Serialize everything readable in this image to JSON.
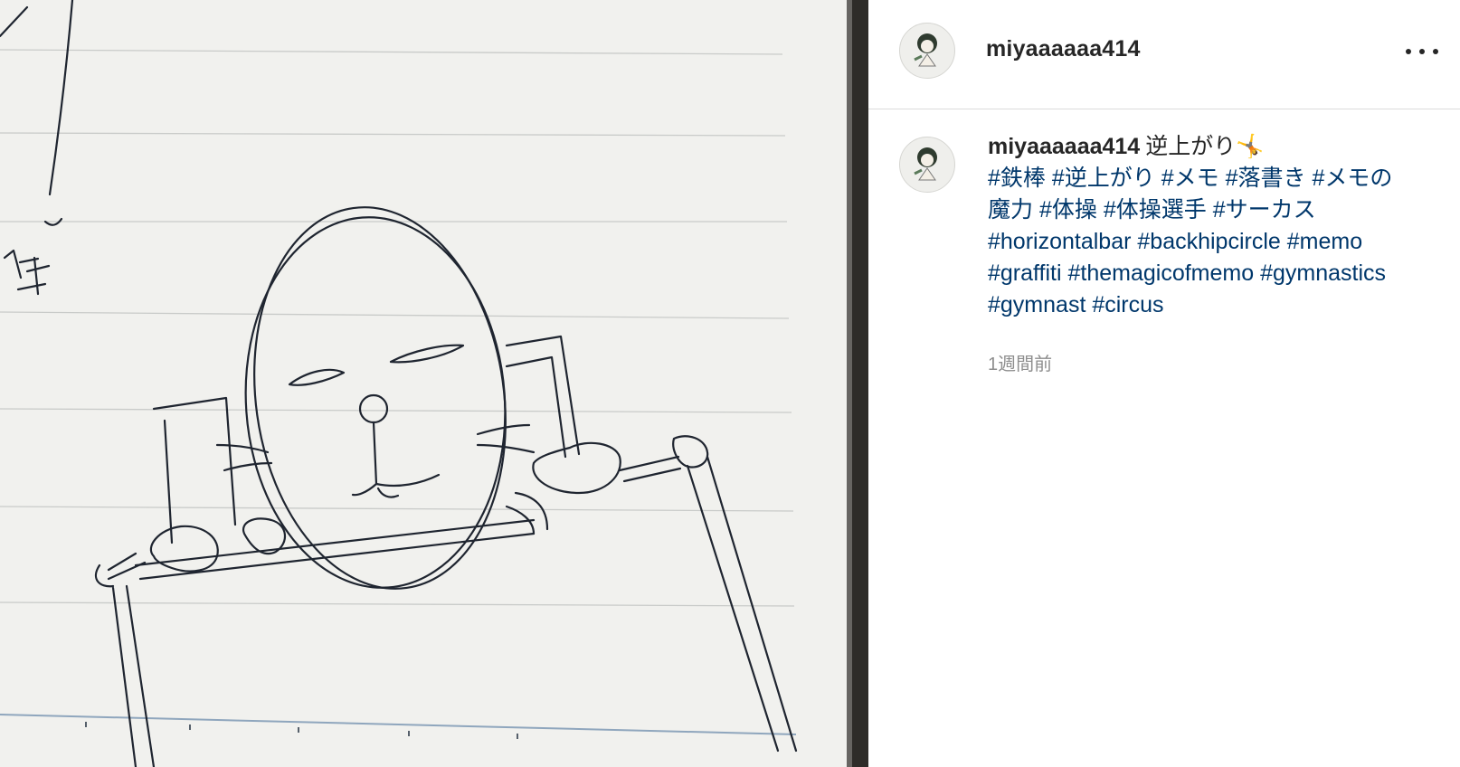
{
  "post": {
    "username": "miyaaaaaa414",
    "menu_icon": "more-horizontal-icon",
    "avatar_icon": "user-avatar-icon",
    "caption": {
      "username": "miyaaaaaa414",
      "text": "逆上がり🤸",
      "hashtags": [
        "#鉄棒",
        "#逆上がり",
        "#メモ",
        "#落書き",
        "#メモの魔力",
        "#体操",
        "#体操選手",
        "#サーカス",
        "#horizontalbar",
        "#backhipcircle",
        "#memo",
        "#graffiti",
        "#themagicofmemo",
        "#gymnastics",
        "#gymnast",
        "#circus"
      ]
    },
    "timestamp": "1週間前"
  },
  "colors": {
    "text": "#262626",
    "hashtag": "#00376b",
    "muted": "#8e8e8e",
    "border": "#dbdbdb",
    "paper": "#f3f3f1",
    "ink": "#1f2530"
  }
}
